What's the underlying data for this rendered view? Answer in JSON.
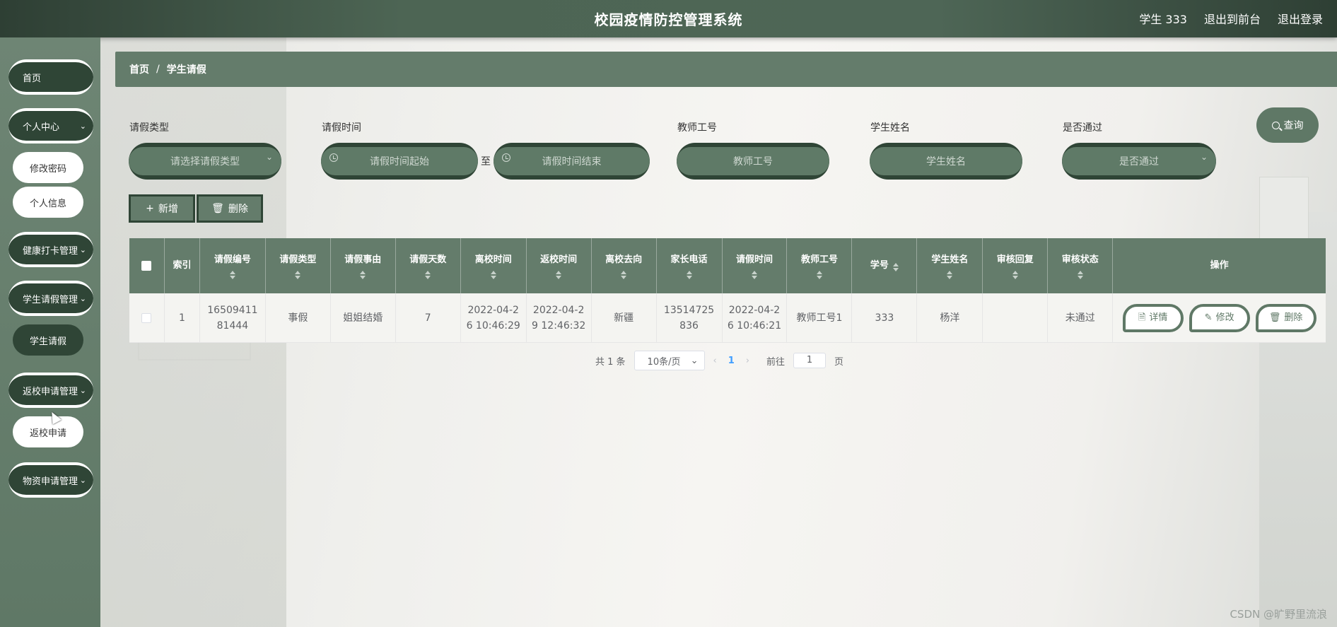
{
  "header": {
    "title": "校园疫情防控管理系统",
    "user": "学生 333",
    "back_front": "退出到前台",
    "logout": "退出登录"
  },
  "sidebar": {
    "home": "首页",
    "personal_center": "个人中心",
    "change_password": "修改密码",
    "personal_info": "个人信息",
    "health_checkin_mgmt": "健康打卡管理",
    "leave_mgmt": "学生请假管理",
    "leave": "学生请假",
    "return_mgmt": "返校申请管理",
    "return_apply": "返校申请",
    "supplies_mgmt": "物资申请管理"
  },
  "breadcrumb": {
    "home": "首页",
    "sep": "/",
    "current": "学生请假"
  },
  "search": {
    "type_label": "请假类型",
    "type_placeholder": "请选择请假类型",
    "time_label": "请假时间",
    "time_start": "请假时间起始",
    "to": "至",
    "time_end": "请假时间结束",
    "teacher_label": "教师工号",
    "teacher_placeholder": "教师工号",
    "student_label": "学生姓名",
    "student_placeholder": "学生姓名",
    "passed_label": "是否通过",
    "passed_placeholder": "是否通过",
    "query": "查询"
  },
  "actions": {
    "add": "新增",
    "delete": "删除"
  },
  "table": {
    "headers": [
      "索引",
      "请假编号",
      "请假类型",
      "请假事由",
      "请假天数",
      "离校时间",
      "返校时间",
      "离校去向",
      "家长电话",
      "请假时间",
      "教师工号",
      "学号",
      "学生姓名",
      "审核回复",
      "审核状态",
      "操作"
    ],
    "row": {
      "index": "1",
      "leave_no_1": "16509411",
      "leave_no_2": "81444",
      "type": "事假",
      "reason": "姐姐结婚",
      "days": "7",
      "leave_time_1": "2022-04-2",
      "leave_time_2": "6 10:46:29",
      "return_time_1": "2022-04-2",
      "return_time_2": "9 12:46:32",
      "destination": "新疆",
      "phone_1": "13514725",
      "phone_2": "836",
      "apply_time_1": "2022-04-2",
      "apply_time_2": "6 10:46:21",
      "teacher_no": "教师工号1",
      "student_no": "333",
      "student_name": "杨洋",
      "review_reply": "",
      "review_status": "未通过",
      "op_detail": "详情",
      "op_edit": "修改",
      "op_delete": "删除"
    }
  },
  "pagination": {
    "total": "共 1 条",
    "page_size": "10条/页",
    "current": "1",
    "goto": "前往",
    "goto_value": "1",
    "page_unit": "页"
  },
  "watermark": "CSDN @旷野里流浪"
}
